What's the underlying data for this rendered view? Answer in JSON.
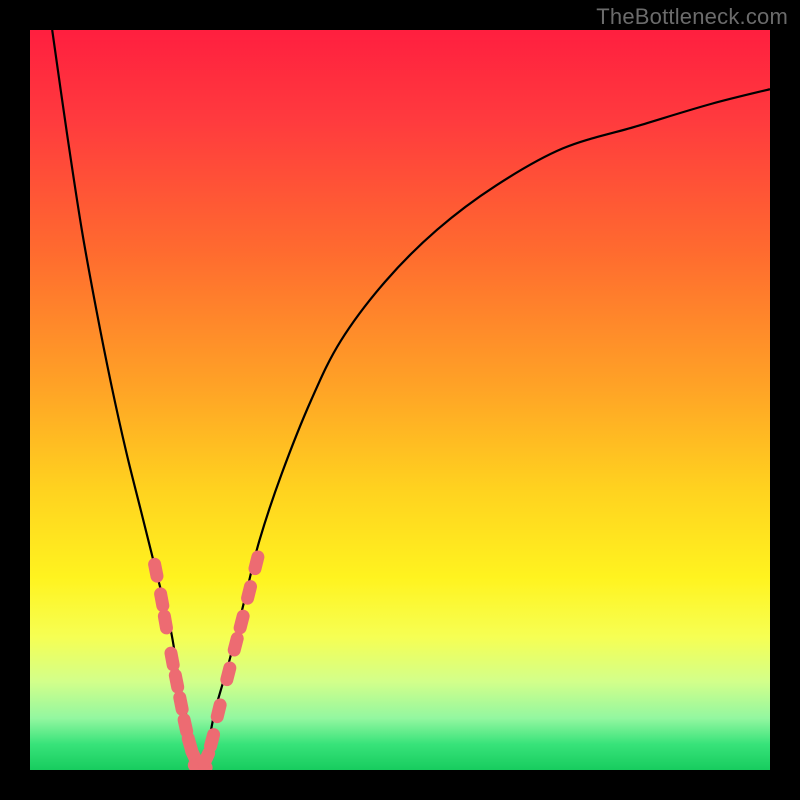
{
  "watermark": "TheBottleneck.com",
  "colors": {
    "frame": "#000000",
    "curve": "#000000",
    "marker_fill": "#ed6b72",
    "marker_stroke": "#ed6b72",
    "gradient_stops": [
      {
        "offset": 0.0,
        "color": "#ff1f3f"
      },
      {
        "offset": 0.12,
        "color": "#ff3a3e"
      },
      {
        "offset": 0.3,
        "color": "#ff6b2f"
      },
      {
        "offset": 0.48,
        "color": "#ffa226"
      },
      {
        "offset": 0.62,
        "color": "#ffd21f"
      },
      {
        "offset": 0.74,
        "color": "#fff31f"
      },
      {
        "offset": 0.82,
        "color": "#f6ff53"
      },
      {
        "offset": 0.88,
        "color": "#d3ff8a"
      },
      {
        "offset": 0.93,
        "color": "#93f7a0"
      },
      {
        "offset": 0.965,
        "color": "#38e37a"
      },
      {
        "offset": 1.0,
        "color": "#17cc5e"
      }
    ]
  },
  "chart_data": {
    "type": "line",
    "title": "",
    "xlabel": "",
    "ylabel": "",
    "xlim": [
      0,
      100
    ],
    "ylim": [
      0,
      100
    ],
    "series": [
      {
        "name": "bottleneck-curve",
        "x": [
          3,
          5,
          7,
          9,
          11,
          13,
          15,
          17,
          19,
          20,
          21,
          22,
          23,
          24,
          25,
          27,
          29,
          31,
          34,
          38,
          42,
          48,
          55,
          63,
          72,
          82,
          92,
          100
        ],
        "y": [
          100,
          86,
          73,
          62,
          52,
          43,
          35,
          27,
          19,
          13,
          8,
          3,
          0,
          3,
          8,
          15,
          23,
          31,
          40,
          50,
          58,
          66,
          73,
          79,
          84,
          87,
          90,
          92
        ]
      }
    ],
    "markers": [
      {
        "x": 17.0,
        "y": 27
      },
      {
        "x": 17.8,
        "y": 23
      },
      {
        "x": 18.3,
        "y": 20
      },
      {
        "x": 19.2,
        "y": 15
      },
      {
        "x": 19.8,
        "y": 12
      },
      {
        "x": 20.4,
        "y": 9
      },
      {
        "x": 21.0,
        "y": 6
      },
      {
        "x": 21.6,
        "y": 3.5
      },
      {
        "x": 22.2,
        "y": 1.8
      },
      {
        "x": 23.0,
        "y": 0.5
      },
      {
        "x": 23.8,
        "y": 1.5
      },
      {
        "x": 24.6,
        "y": 4
      },
      {
        "x": 25.5,
        "y": 8
      },
      {
        "x": 26.8,
        "y": 13
      },
      {
        "x": 27.8,
        "y": 17
      },
      {
        "x": 28.6,
        "y": 20
      },
      {
        "x": 29.6,
        "y": 24
      },
      {
        "x": 30.6,
        "y": 28
      }
    ]
  }
}
